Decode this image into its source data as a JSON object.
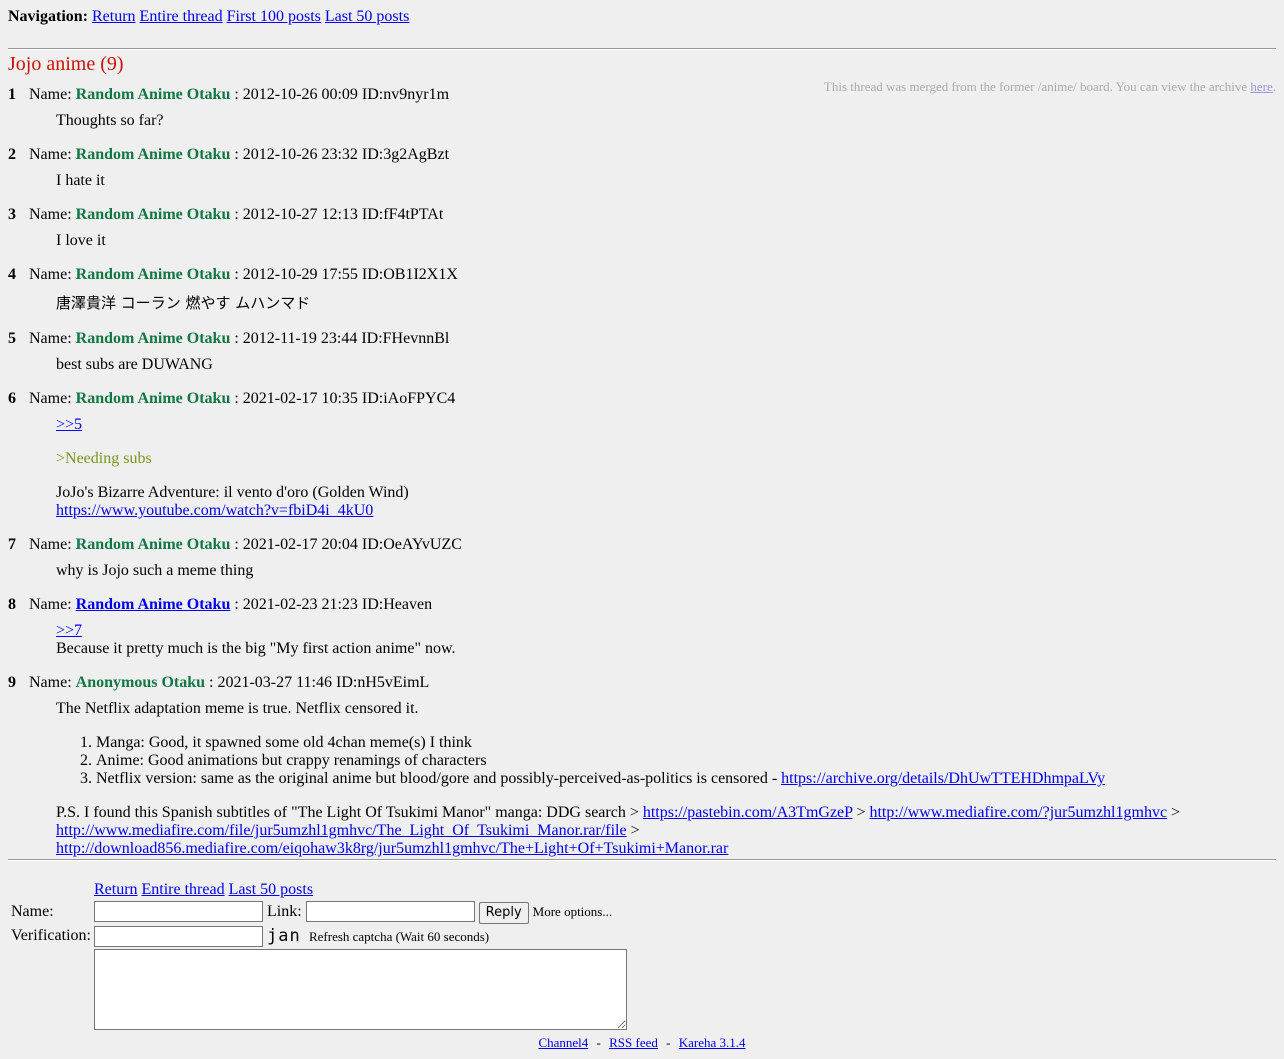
{
  "nav": {
    "label": "Navigation:",
    "links": [
      "Return",
      "Entire thread",
      "First 100 posts",
      "Last 50 posts"
    ]
  },
  "thread": {
    "title": "Jojo anime (9)",
    "notice_text": "This thread was merged from the former /anime/ board. You can view the archive",
    "notice_link": "here",
    "notice_end": "."
  },
  "name_label": "Name:",
  "posts": [
    {
      "num": "1",
      "name": "Random Anime Otaku",
      "meta": ": 2012-10-26 00:09 ID:nv9nyr1m",
      "body": "Thoughts so far?"
    },
    {
      "num": "2",
      "name": "Random Anime Otaku",
      "meta": ": 2012-10-26 23:32 ID:3g2AgBzt",
      "body": "I hate it"
    },
    {
      "num": "3",
      "name": "Random Anime Otaku",
      "meta": ": 2012-10-27 12:13 ID:fF4tPTAt",
      "body": "I love it"
    },
    {
      "num": "4",
      "name": "Random Anime Otaku",
      "meta": ": 2012-10-29 17:55 ID:OB1I2X1X",
      "body": "唐澤貴洋 コーラン 燃やす ムハンマド"
    },
    {
      "num": "5",
      "name": "Random Anime Otaku",
      "meta": ": 2012-11-19 23:44 ID:FHevnnBl",
      "body": "best subs are DUWANG"
    },
    {
      "num": "6",
      "name": "Random Anime Otaku",
      "meta": ": 2021-02-17 10:35 ID:iAoFPYC4",
      "reply": ">>5",
      "quote": ">Needing subs",
      "line1": "JoJo's Bizarre Adventure: il vento d'oro (Golden Wind)",
      "link": "https://www.youtube.com/watch?v=fbiD4i_4kU0"
    },
    {
      "num": "7",
      "name": "Random Anime Otaku",
      "meta": ": 2021-02-17 20:04 ID:OeAYvUZC",
      "body": "why is Jojo such a meme thing"
    },
    {
      "num": "8",
      "name": "Random Anime Otaku",
      "meta": ": 2021-02-23 21:23 ID:Heaven",
      "reply": ">>7",
      "body": "Because it pretty much is the big \"My first action anime\" now."
    },
    {
      "num": "9",
      "name": "Anonymous Otaku",
      "meta": ": 2021-03-27 11:46 ID:nH5vEimL",
      "body": "The Netflix adaptation meme is true. Netflix censored it.",
      "list": [
        "Manga: Good, it spawned some old 4chan meme(s) I think",
        "Anime: Good animations but crappy renamings of characters",
        "Netflix version: same as the original anime but blood/gore and possibly-perceived-as-politics is censored - "
      ],
      "list_link": "https://archive.org/details/DhUwTTEHDhmpaLVy",
      "ps_text": "P.S. I found this Spanish subtitles of \"The Light Of Tsukimi Manor\" manga: DDG search > ",
      "ps_link1": "https://pastebin.com/A3TmGzeP",
      "sep": " > ",
      "ps_link2": "http://www.mediafire.com/?jur5umzhl1gmhvc",
      "ps_link3": "http://www.mediafire.com/file/jur5umzhl1gmhvc/The_Light_Of_Tsukimi_Manor.rar/file",
      "ps_link4": "http://download856.mediafire.com/eiqohaw3k8rg/jur5umzhl1gmhvc/The+Light+Of+Tsukimi+Manor.rar"
    }
  ],
  "form": {
    "links": [
      "Return",
      "Entire thread",
      "Last 50 posts"
    ],
    "name_label": "Name:",
    "link_label": "Link:",
    "reply_button": "Reply",
    "more_options": "More options...",
    "verification_label": "Verification:",
    "captcha_text": "jan",
    "refresh_text": "Refresh captcha (Wait 60 seconds)"
  },
  "footer": {
    "links": [
      "Channel4",
      "RSS feed",
      "Kareha 3.1.4"
    ],
    "separator": "-"
  }
}
